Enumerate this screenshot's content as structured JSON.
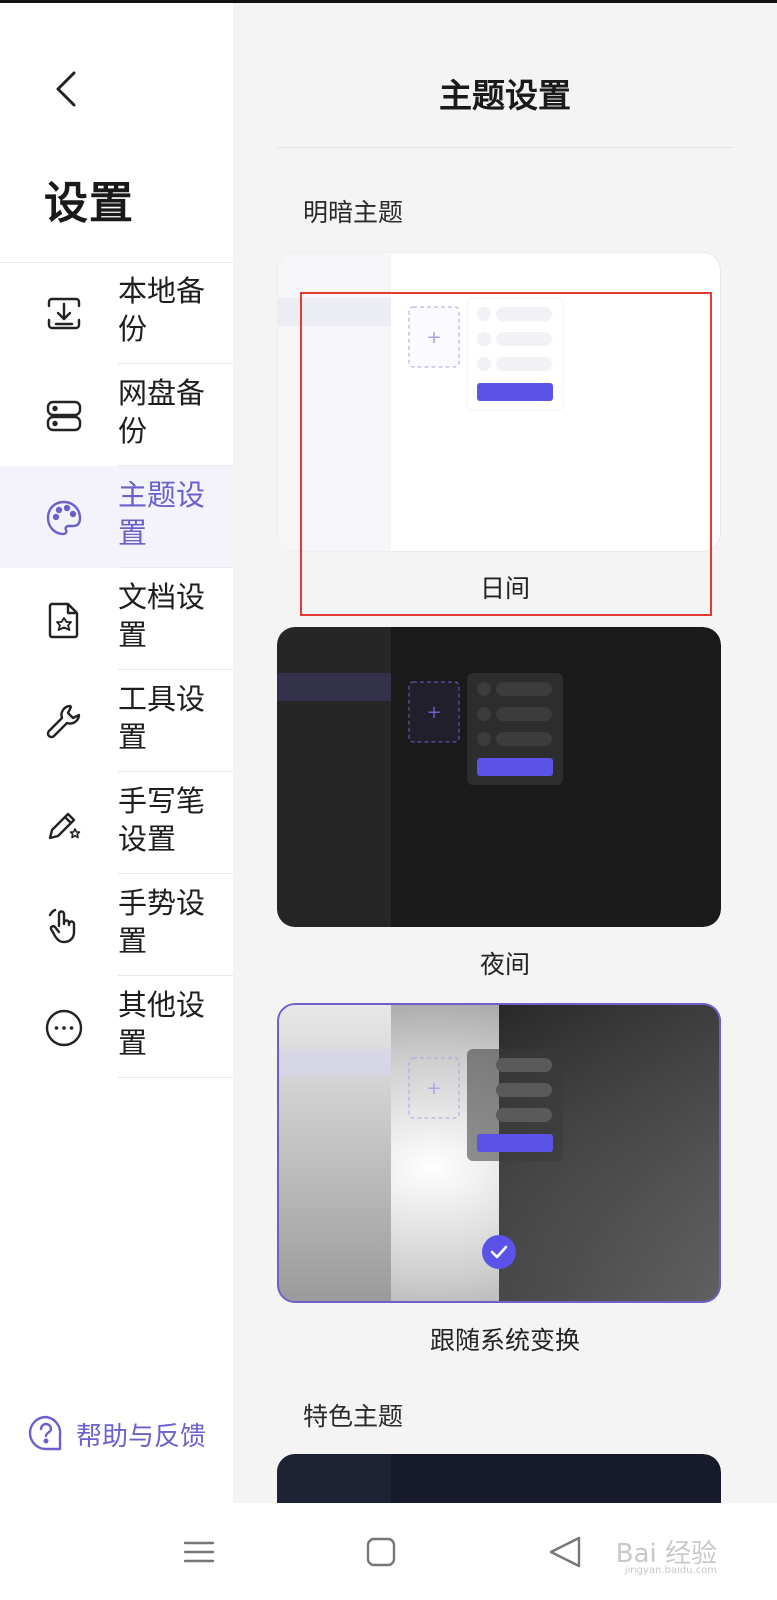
{
  "sidebar": {
    "title": "设置",
    "items": [
      {
        "label": "本地备份",
        "icon": "local-backup-icon",
        "active": false
      },
      {
        "label": "网盘备份",
        "icon": "cloud-drive-icon",
        "active": false
      },
      {
        "label": "主题设置",
        "icon": "palette-icon",
        "active": true
      },
      {
        "label": "文档设置",
        "icon": "document-settings-icon",
        "active": false
      },
      {
        "label": "工具设置",
        "icon": "wrench-icon",
        "active": false
      },
      {
        "label": "手写笔设置",
        "icon": "pen-settings-icon",
        "active": false
      },
      {
        "label": "手势设置",
        "icon": "gesture-hand-icon",
        "active": false
      },
      {
        "label": "其他设置",
        "icon": "more-icon",
        "active": false
      }
    ],
    "help_label": "帮助与反馈"
  },
  "main": {
    "title": "主题设置",
    "section_light_dark": "明暗主题",
    "themes": [
      {
        "label": "日间",
        "selected": false
      },
      {
        "label": "夜间",
        "selected": false
      },
      {
        "label": "跟随系统变换",
        "selected": true
      }
    ],
    "section_featured": "特色主题"
  },
  "watermark": {
    "text": "Bai 经验",
    "sub": "jingyan.baidu.com"
  },
  "colors": {
    "accent": "#6c60cc",
    "button": "#5b52e8",
    "highlight": "#e53935",
    "dark_card": "#1a1a1a"
  }
}
